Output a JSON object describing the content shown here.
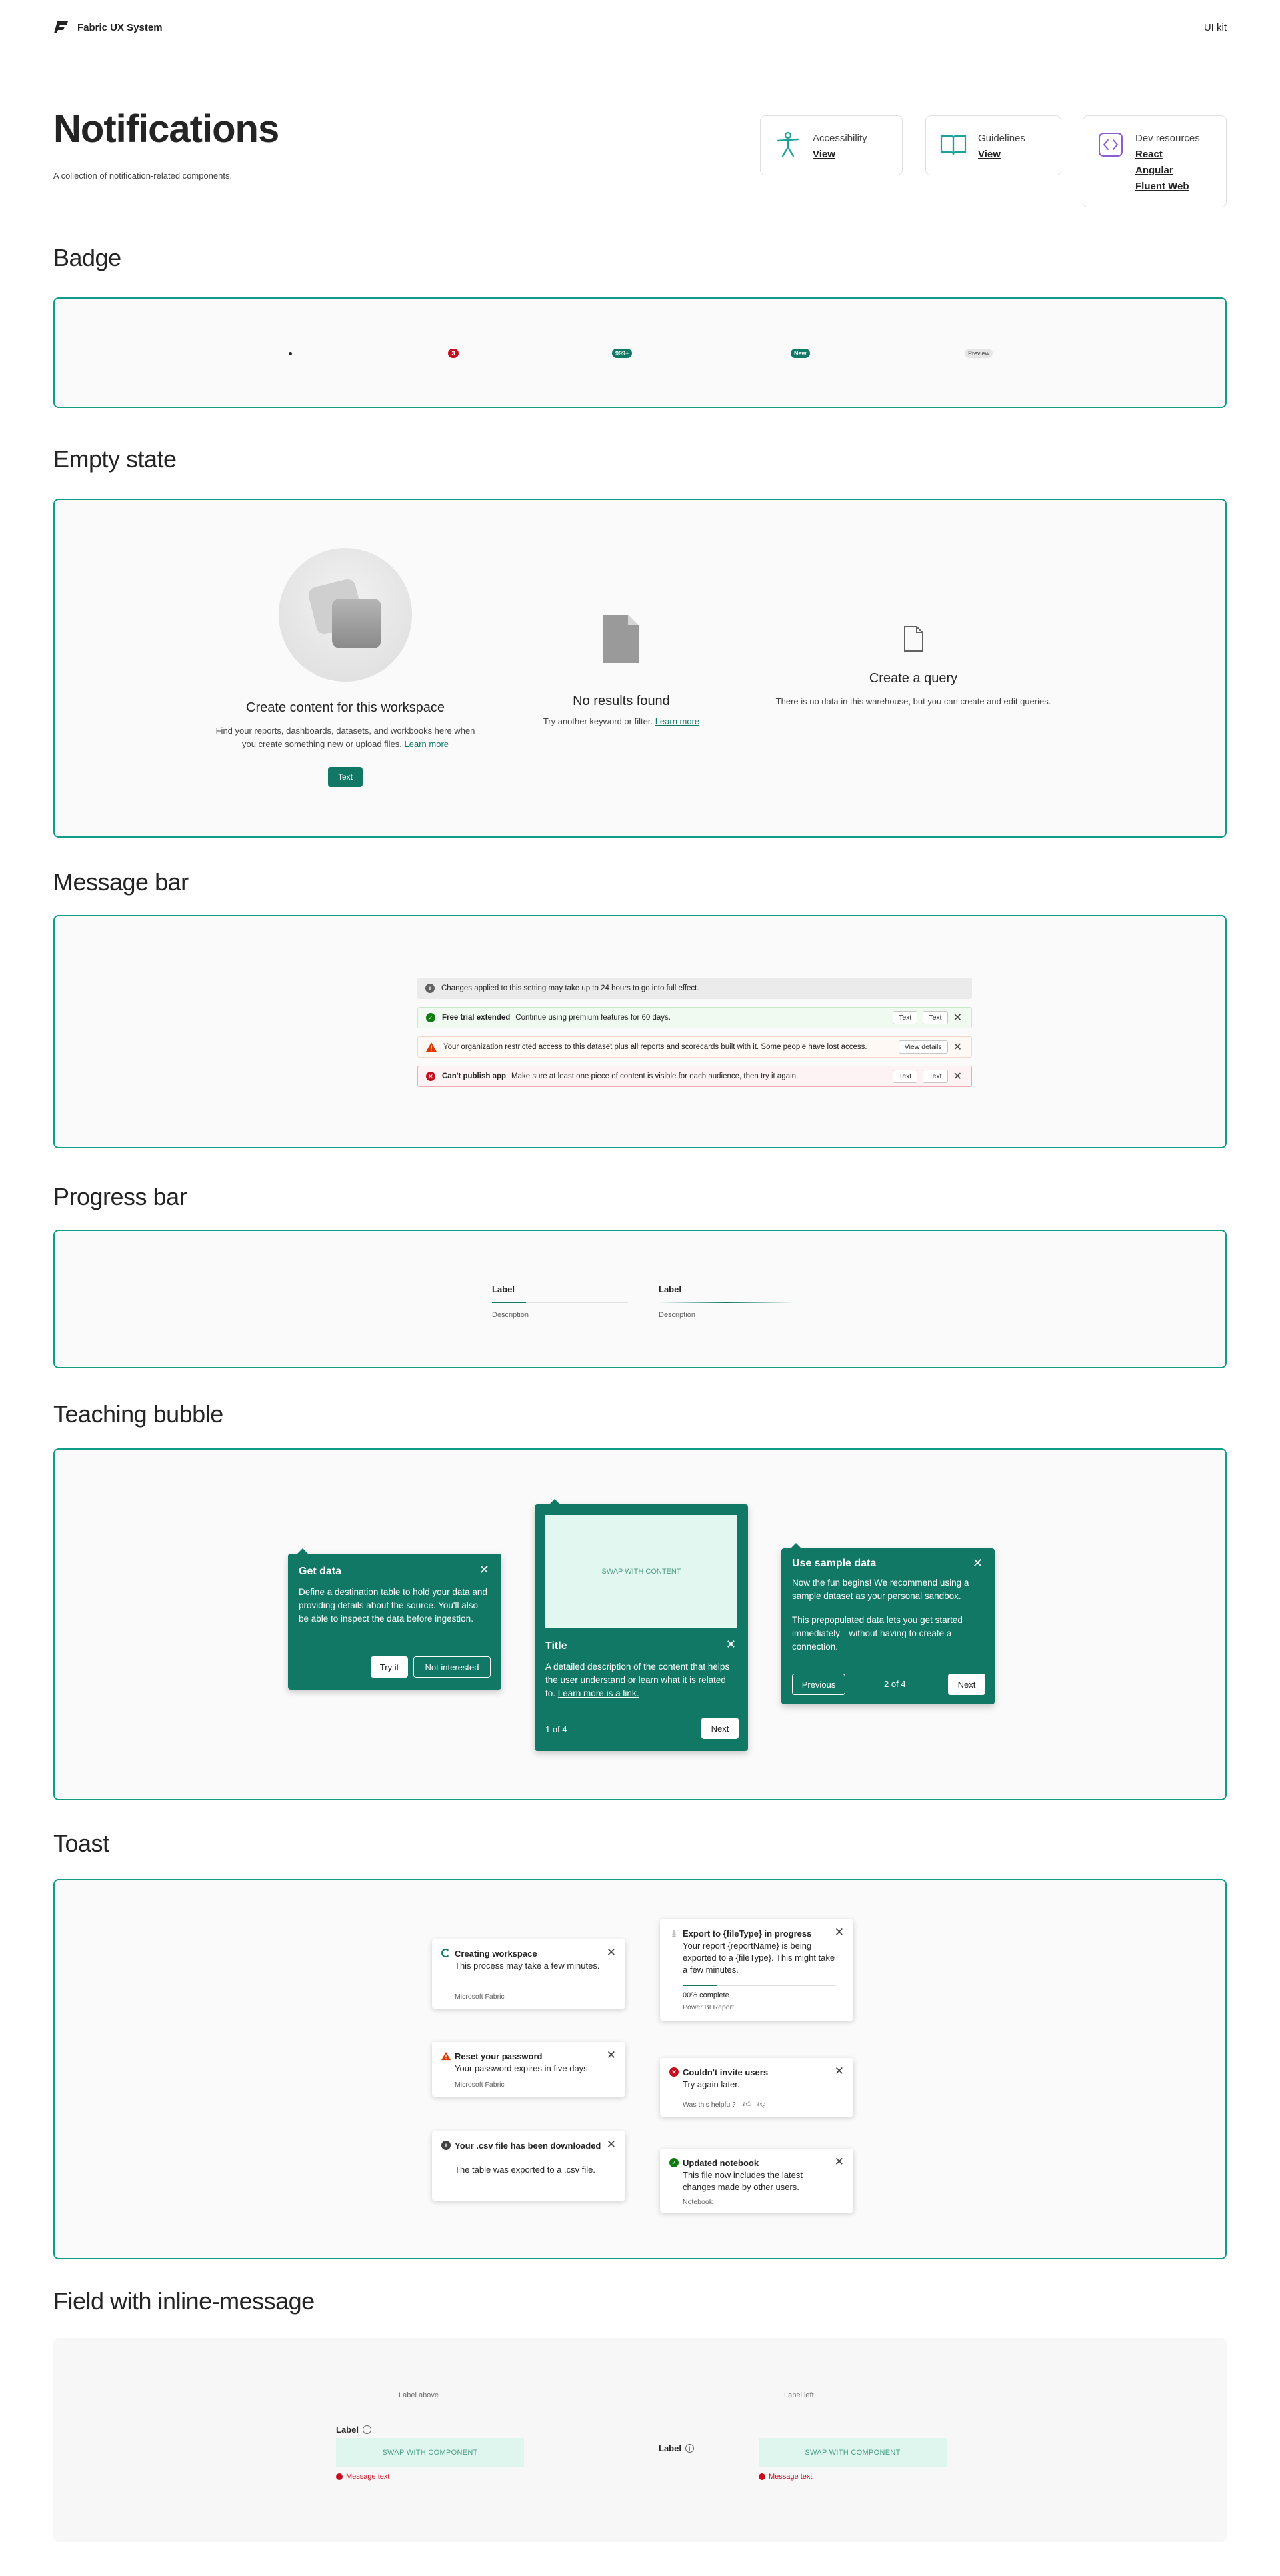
{
  "brand": "Fabric UX System",
  "uikit": "UI kit",
  "page": {
    "title": "Notifications",
    "subtitle": "A collection of notification-related components."
  },
  "resources": [
    {
      "label": "Accessibility",
      "links": [
        "View"
      ]
    },
    {
      "label": "Guidelines",
      "links": [
        "View"
      ]
    },
    {
      "label": "Dev resources",
      "links": [
        "React",
        "Angular",
        "Fluent Web"
      ]
    }
  ],
  "sections": {
    "badge": "Badge",
    "empty_state": "Empty state",
    "message_bar": "Message bar",
    "progress_bar": "Progress bar",
    "teaching_bubble": "Teaching bubble",
    "toast": "Toast",
    "field": "Field with inline-message"
  },
  "badges": {
    "count": "3",
    "overflow": "999+",
    "new": "New",
    "preview": "Preview"
  },
  "empty": {
    "card1": {
      "title": "Create content for this workspace",
      "text": "Find your reports, dashboards, datasets, and workbooks here when you create something new or upload files.",
      "link": "Learn more",
      "button": "Text"
    },
    "card2": {
      "title": "No results found",
      "text": "Try another keyword or filter.",
      "link": "Learn more"
    },
    "card3": {
      "title": "Create a query",
      "text": "There is no data in this warehouse, but you can create and edit queries."
    }
  },
  "messages": [
    {
      "title": "",
      "text": "Changes applied to this setting may take up to 24 hours to go into full effect."
    },
    {
      "title": "Free trial extended",
      "text": "Continue using premium features for 60 days.",
      "actions": [
        "Text",
        "Text"
      ]
    },
    {
      "title": "",
      "text": "Your organization restricted access to this dataset plus all reports and scorecards built with it. Some people have lost access.",
      "actions": [
        "View details"
      ]
    },
    {
      "title": "Can't publish app",
      "text": "Make sure at least one piece of content is visible for each audience, then try it again.",
      "actions": [
        "Text",
        "Text"
      ]
    }
  ],
  "progress": [
    {
      "label": "Label",
      "description": "Description",
      "value": 0.25
    },
    {
      "label": "Label",
      "description": "Description",
      "value": 0.4
    }
  ],
  "bubbles": {
    "b1": {
      "title": "Get data",
      "text": "Define a destination table to hold your data and providing details about the source. You'll also be able to inspect the data before ingestion.",
      "primary": "Try it",
      "secondary": "Not interested"
    },
    "b2": {
      "media": "SWAP WITH CONTENT",
      "title": "Title",
      "text": "A detailed description of the content that helps the user understand or learn what it is related to.",
      "link": "Learn more is a link.",
      "counter": "1 of 4",
      "next": "Next"
    },
    "b3": {
      "title": "Use sample data",
      "text1": "Now the fun begins! We recommend using a sample dataset as your personal sandbox.",
      "text2": "This prepopulated data lets you get started immediately—without having to create a connection.",
      "prev": "Previous",
      "counter": "2 of 4",
      "next": "Next"
    }
  },
  "toasts": {
    "t1": {
      "title": "Creating workspace",
      "text": "This process may take a few minutes.",
      "footer": "Microsoft Fabric"
    },
    "t2": {
      "title": "Reset your password",
      "text": "Your password expires in five days.",
      "footer": "Microsoft Fabric"
    },
    "t3": {
      "title": "Your .csv file has been downloaded",
      "text": "The table was exported to a .csv file."
    },
    "t4": {
      "title": "Export to {fileType} in progress",
      "text": "Your report {reportName} is being exported to a {fileType}. This might take a few minutes.",
      "progress": "00% complete",
      "footer": "Power BI Report"
    },
    "t5": {
      "title": "Couldn't invite users",
      "text": "Try again later.",
      "footer": "Was this helpful?"
    },
    "t6": {
      "title": "Updated notebook",
      "text": "This file now includes the latest changes made by other users.",
      "footer": "Notebook"
    }
  },
  "fields": {
    "above": {
      "caption": "Label above",
      "label": "Label",
      "component": "SWAP WITH COMPONENT",
      "message": "Message text"
    },
    "left": {
      "caption": "Label left",
      "label": "Label",
      "component": "SWAP WITH COMPONENT",
      "message": "Message text"
    }
  },
  "colors": {
    "brand": "#117865",
    "accent_border": "#0f9d8a",
    "error": "#c50f1f",
    "warning": "#da3b01",
    "success": "#107c10"
  }
}
